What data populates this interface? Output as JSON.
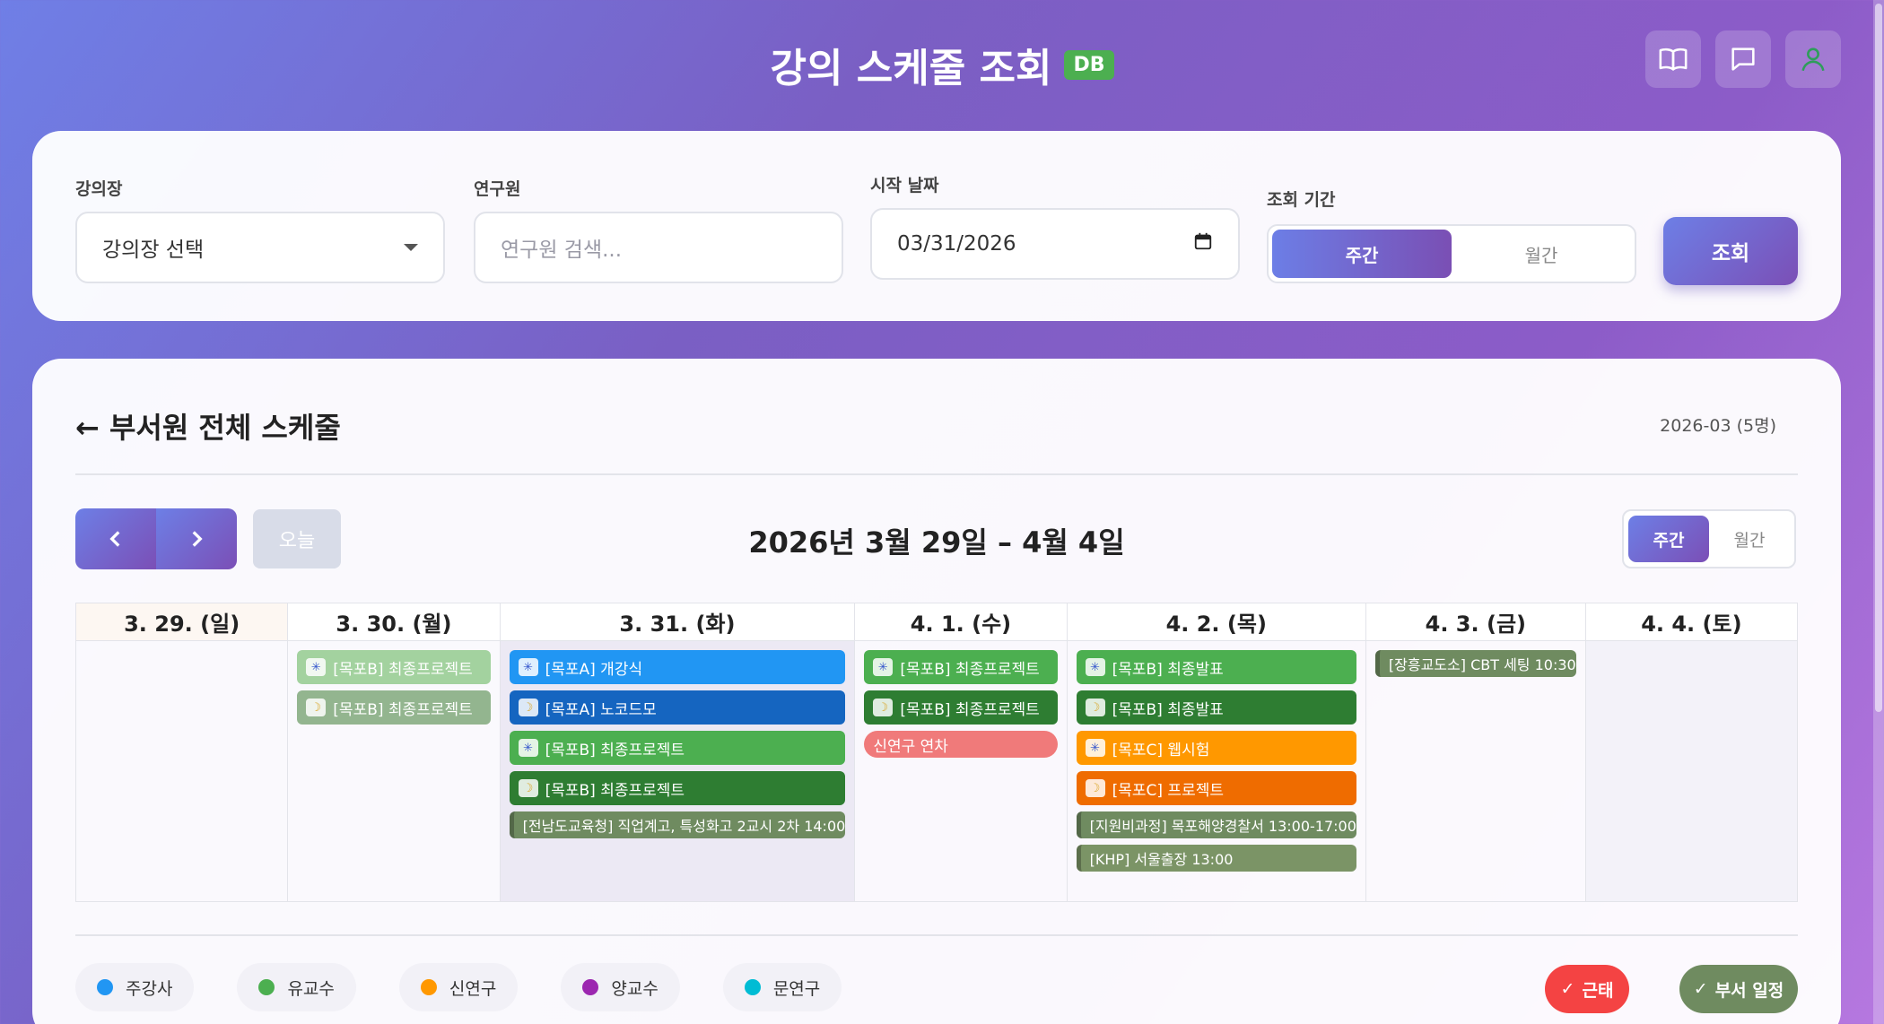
{
  "header": {
    "title": "강의 스케줄 조회",
    "badge": "DB",
    "icons": [
      "book-icon",
      "chat-icon",
      "user-icon"
    ]
  },
  "filters": {
    "lecture_room_label": "강의장",
    "lecture_room_value": "강의장 선택",
    "researcher_label": "연구원",
    "researcher_placeholder": "연구원 검색...",
    "start_date_label": "시작 날짜",
    "start_date_value": "03/31/2026",
    "period_label": "조회 기간",
    "period_options": [
      "주간",
      "월간"
    ],
    "period_selected": "주간",
    "query_button": "조회"
  },
  "schedule": {
    "title": "← 부서원 전체 스케줄",
    "meta": "2026-03 (5명)",
    "today_button": "오늘",
    "range_title": "2026년 3월 29일 – 4월 4일",
    "view_options": [
      "주간",
      "월간"
    ],
    "view_selected": "주간",
    "days": [
      {
        "label": "3. 29. (일)",
        "events": []
      },
      {
        "label": "3. 30. (월)",
        "events": [
          {
            "icon": "sun",
            "text": "[목포B] 최종프로젝트",
            "color": "#a3d29f"
          },
          {
            "icon": "moon",
            "text": "[목포B] 최종프로젝트",
            "color": "#93b58f"
          }
        ]
      },
      {
        "label": "3. 31. (화)",
        "events": [
          {
            "icon": "sun",
            "text": "[목포A] 개강식",
            "color": "#2196f3"
          },
          {
            "icon": "moon",
            "text": "[목포A] 노코드모",
            "color": "#1565c0"
          },
          {
            "icon": "sun",
            "text": "[목포B] 최종프로젝트",
            "color": "#4caf50"
          },
          {
            "icon": "moon",
            "text": "[목포B] 최종프로젝트",
            "color": "#2e7d32"
          },
          {
            "icon": "",
            "text": "[전남도교육청] 직업계고, 특성화고 2교시 2차 14:00",
            "color": "#6f8b60",
            "small": true
          }
        ]
      },
      {
        "label": "4. 1. (수)",
        "events": [
          {
            "icon": "sun",
            "text": "[목포B] 최종프로젝트",
            "color": "#4caf50"
          },
          {
            "icon": "moon",
            "text": "[목포B] 최종프로젝트",
            "color": "#2e7d32"
          },
          {
            "icon": "",
            "text": "신연구 연차",
            "color": "#f07a7a",
            "pill": true
          }
        ]
      },
      {
        "label": "4. 2. (목)",
        "events": [
          {
            "icon": "sun",
            "text": "[목포B] 최종발표",
            "color": "#4caf50"
          },
          {
            "icon": "moon",
            "text": "[목포B] 최종발표",
            "color": "#2e7d32"
          },
          {
            "icon": "sun",
            "text": "[목포C] 웹시험",
            "color": "#ff9800"
          },
          {
            "icon": "moon",
            "text": "[목포C] 프로젝트",
            "color": "#ef6c00"
          },
          {
            "icon": "",
            "text": "[지원비과정] 목포해양경찰서 13:00-17:00",
            "color": "#6f8b60",
            "small": true
          },
          {
            "icon": "",
            "text": "[KHP] 서울출장 13:00",
            "color": "#7b9466",
            "small": true
          }
        ]
      },
      {
        "label": "4. 3. (금)",
        "events": [
          {
            "icon": "",
            "text": "[장흥교도소] CBT 세팅 10:30",
            "color": "#6f8b60",
            "small": true
          }
        ]
      },
      {
        "label": "4. 4. (토)",
        "events": []
      }
    ]
  },
  "legend": [
    {
      "name": "주강사",
      "color": "#2196f3"
    },
    {
      "name": "유교수",
      "color": "#4caf50"
    },
    {
      "name": "신연구",
      "color": "#ff9800"
    },
    {
      "name": "양교수",
      "color": "#9c27b0"
    },
    {
      "name": "문연구",
      "color": "#00bcd4"
    }
  ],
  "actions": {
    "attendance": "근태",
    "dept_schedule": "부서 일정"
  }
}
